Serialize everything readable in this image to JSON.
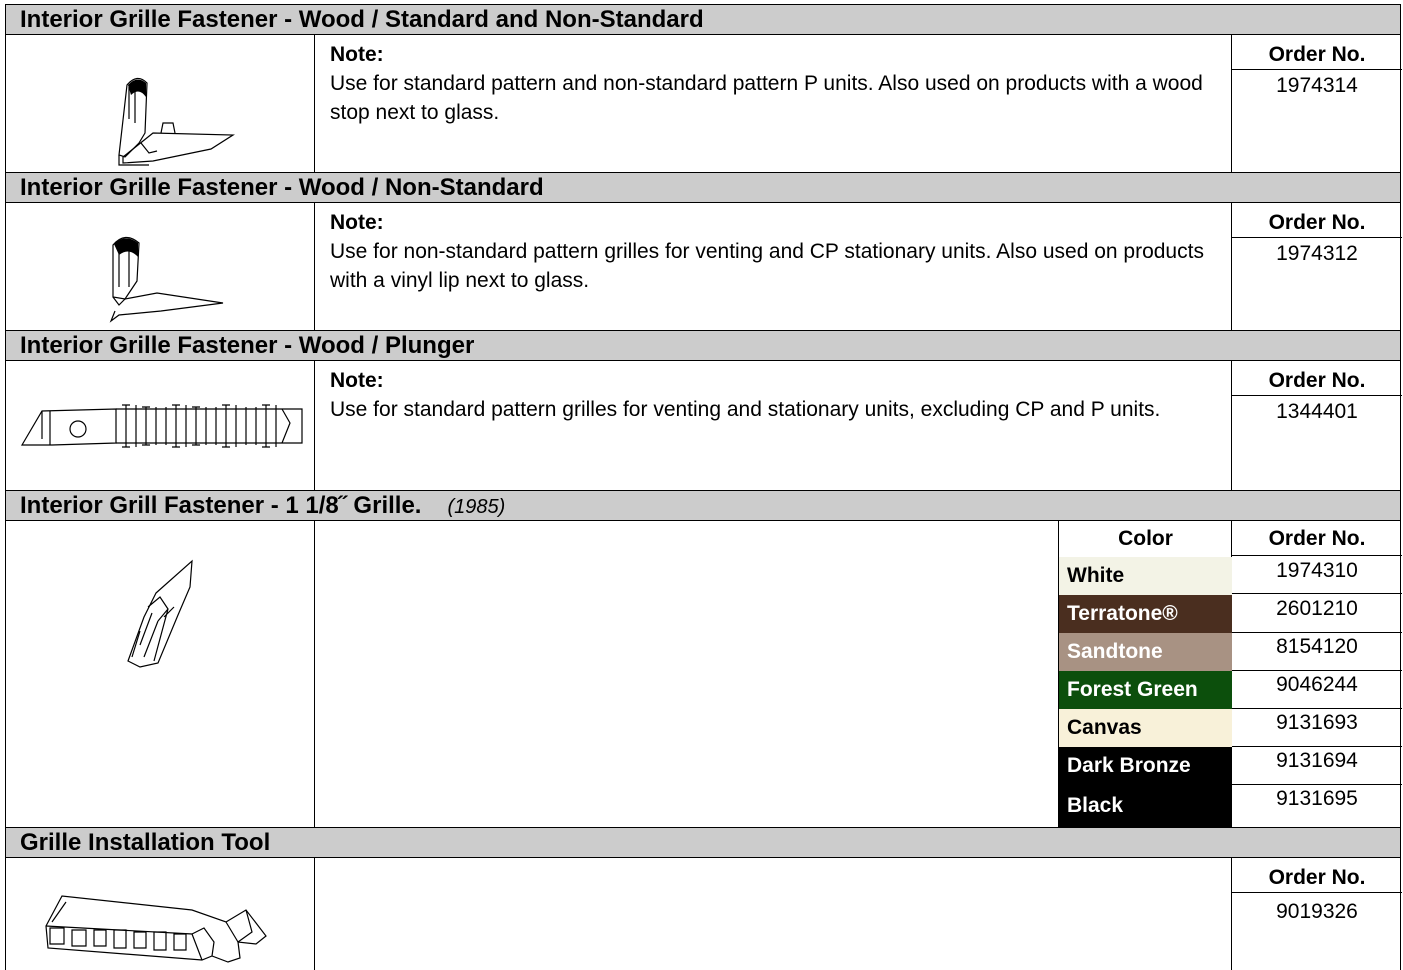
{
  "sections": [
    {
      "title": "Interior Grille Fastener - Wood / Standard and Non-Standard",
      "note_label": "Note:",
      "note_text": "Use for standard pattern and non-standard pattern P units. Also used on products with a wood stop next to glass.",
      "order_header": "Order No.",
      "order_no": "1974314",
      "image": "fastener-standard-drawing"
    },
    {
      "title": "Interior Grille Fastener - Wood / Non-Standard",
      "note_label": "Note:",
      "note_text": "Use for non-standard pattern grilles for venting and CP stationary units. Also used on products with a vinyl lip next to glass.",
      "order_header": "Order No.",
      "order_no": "1974312",
      "image": "fastener-non-standard-drawing"
    },
    {
      "title": "Interior Grille Fastener - Wood / Plunger",
      "note_label": "Note:",
      "note_text": "Use for standard pattern grilles for venting and stationary units, excluding CP and P units.",
      "order_header": "Order No.",
      "order_no": "1344401",
      "image": "plunger-fastener-drawing"
    },
    {
      "title": "Interior Grill Fastener - 1 1/8˝ Grille.",
      "year": "(1985)",
      "color_header": "Color",
      "order_header": "Order No.",
      "image": "clip-fastener-drawing",
      "colors": [
        {
          "name": "White",
          "order_no": "1974310",
          "bg": "#f3f3e6",
          "fg": "#000000"
        },
        {
          "name": "Terratone®",
          "order_no": "2601210",
          "bg": "#4a2e1f",
          "fg": "#ffffff"
        },
        {
          "name": "Sandtone",
          "order_no": "8154120",
          "bg": "#a89283",
          "fg": "#ffffff"
        },
        {
          "name": "Forest Green",
          "order_no": "9046244",
          "bg": "#0c4f0c",
          "fg": "#ffffff"
        },
        {
          "name": "Canvas",
          "order_no": "9131693",
          "bg": "#f8f1d9",
          "fg": "#000000"
        },
        {
          "name": "Dark Bronze",
          "order_no": "9131694",
          "bg": "#000000",
          "fg": "#ffffff"
        },
        {
          "name": "Black",
          "order_no": "9131695",
          "bg": "#000000",
          "fg": "#ffffff"
        }
      ]
    },
    {
      "title": "Grille Installation Tool",
      "order_header": "Order No.",
      "order_no": "9019326",
      "image": "installation-tool-drawing"
    }
  ]
}
